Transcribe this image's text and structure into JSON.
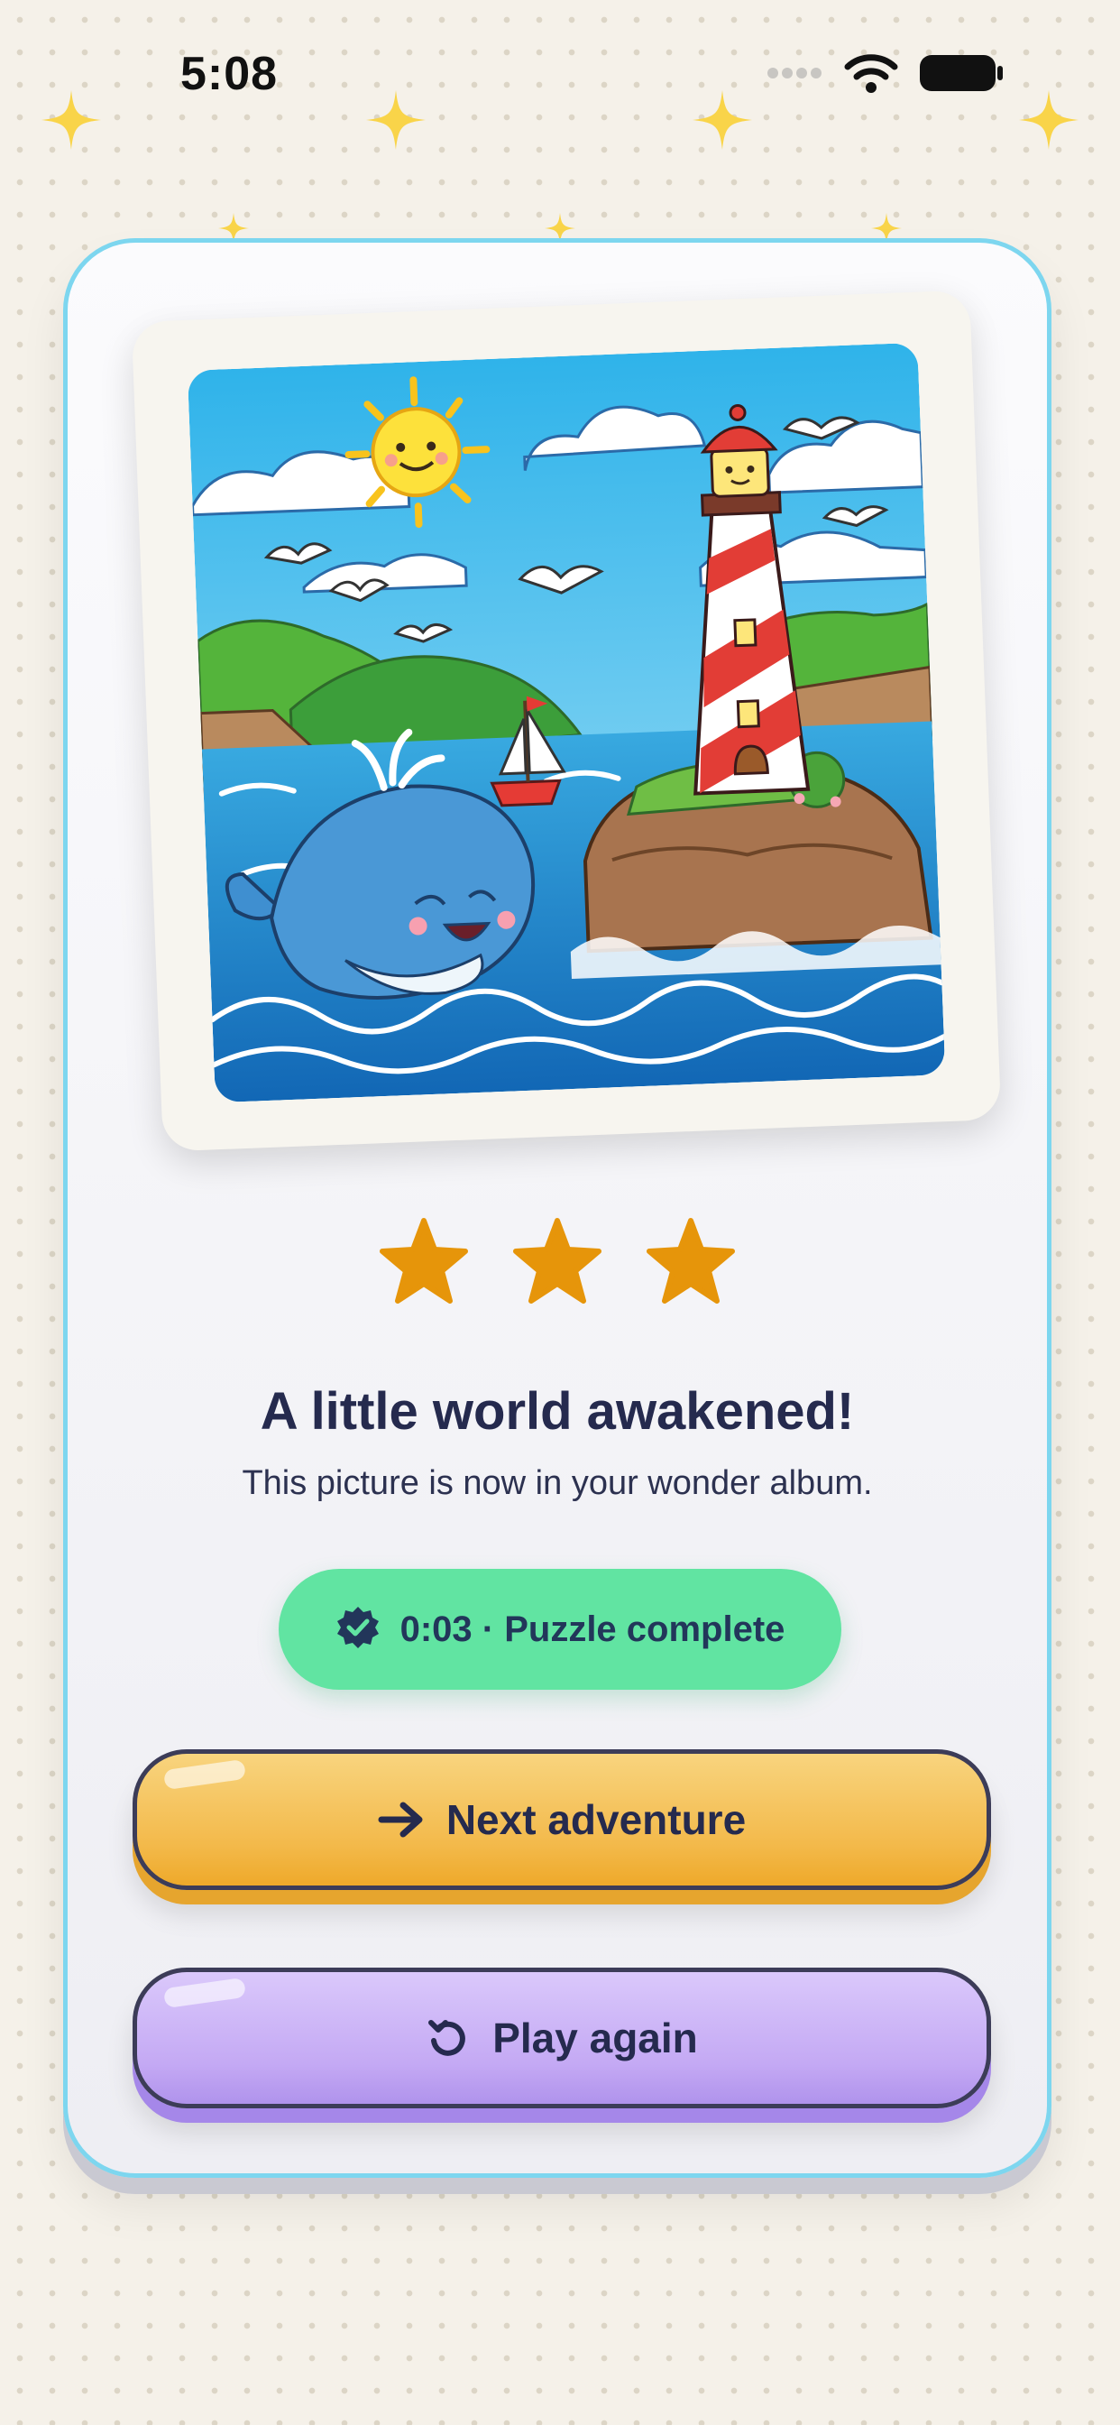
{
  "status_bar": {
    "time": "5:08"
  },
  "hero_image": {
    "description_icon": "lighthouse-whale-illustration"
  },
  "rating": {
    "stars_earned": 3,
    "stars_total": 3,
    "star_color": "#e6950a"
  },
  "title": "A little world awakened!",
  "subtitle": "This picture is now in your wonder album.",
  "completion_badge": {
    "text": "0:03 · Puzzle complete",
    "icon": "check-badge-icon",
    "color": "#61e4a2"
  },
  "actions": {
    "next": {
      "label": "Next adventure",
      "icon": "arrow-right-icon",
      "color": "#f3b94a"
    },
    "replay": {
      "label": "Play again",
      "icon": "restart-icon",
      "color": "#c4a9f4"
    }
  },
  "colors": {
    "card_border": "#7dd6ef",
    "text_primary": "#252a4e",
    "background": "#f5f1e9"
  }
}
